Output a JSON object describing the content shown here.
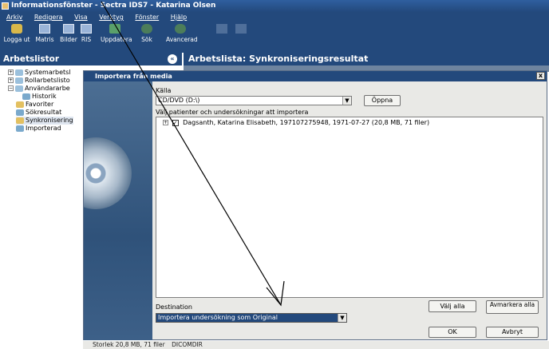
{
  "window": {
    "title": "Informationsfönster - Sectra IDS7 - Katarina Olsen"
  },
  "menu": [
    "Arkiv",
    "Redigera",
    "Visa",
    "Verktyg",
    "Fönster",
    "Hjälp"
  ],
  "toolbar": [
    {
      "label": "Logga ut",
      "icon": "key-icon"
    },
    {
      "label": "Matris",
      "icon": "matrix-icon"
    },
    {
      "label": "Bilder",
      "icon": "images-icon"
    },
    {
      "label": "RIS",
      "icon": "ris-icon"
    },
    {
      "label": "Uppdatera",
      "icon": "refresh-icon"
    },
    {
      "label": "Sök",
      "icon": "binoculars-icon"
    },
    {
      "label": "Avancerad",
      "icon": "advanced-search-icon"
    }
  ],
  "left_panel": {
    "title": "Arbetslistor",
    "items": [
      {
        "label": "Systemarbetsl"
      },
      {
        "label": "Rollarbetslisto"
      },
      {
        "label": "Användararbe"
      },
      {
        "label": "Historik"
      },
      {
        "label": "Favoriter"
      },
      {
        "label": "Sökresultat"
      },
      {
        "label": "Synkronisering"
      },
      {
        "label": "Importerad"
      }
    ]
  },
  "main_title": "Arbetslista: Synkroniseringsresultat",
  "dialog": {
    "title": "Importera från media",
    "source_label": "Källa",
    "source_value": "CD/DVD (D:\\)",
    "open_button": "Öppna",
    "list_label": "Välj patienter och undersökningar att importera",
    "patient_entry": "Dagsanth, Katarina Elisabeth, 197107275948, 1971-07-27 (20,8 MB, 71 filer)",
    "destination_label": "Destination",
    "destination_value": "Importera undersökning som Original",
    "select_all": "Välj alla",
    "deselect_all": "Avmarkera alla",
    "ok": "OK",
    "cancel": "Avbryt",
    "close": "x"
  },
  "status": {
    "size": "Storlek 20,8 MB, 71 filer",
    "dicomdir": "DICOMDIR"
  },
  "colors": {
    "header": "#23497c",
    "selection": "#23497c"
  }
}
